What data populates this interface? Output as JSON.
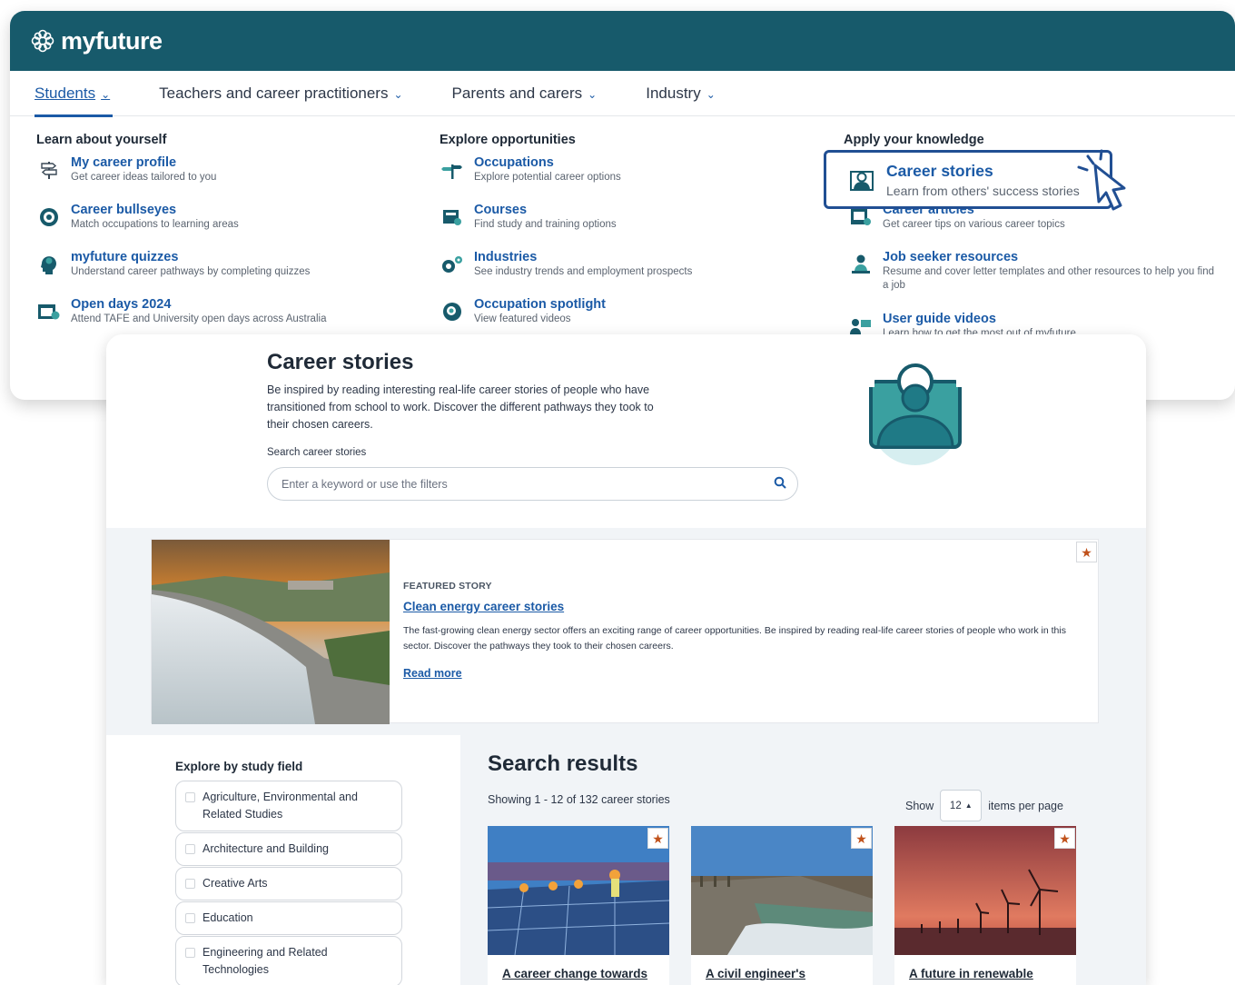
{
  "header": {
    "brand": "myfuture",
    "nav": [
      {
        "label": "Students"
      },
      {
        "label": "Teachers and career practitioners"
      },
      {
        "label": "Parents and carers"
      },
      {
        "label": "Industry"
      }
    ]
  },
  "mega_menu": {
    "columns": [
      {
        "heading": "Learn about yourself",
        "items": [
          {
            "title": "My career profile",
            "desc": "Get career ideas tailored to you",
            "icon": "signpost-icon"
          },
          {
            "title": "Career bullseyes",
            "desc": "Match occupations to learning areas",
            "icon": "target-icon"
          },
          {
            "title": "myfuture quizzes",
            "desc": "Understand career pathways by completing quizzes",
            "icon": "head-bulb-icon"
          },
          {
            "title": "Open days 2024",
            "desc": "Attend TAFE and University open days across Australia",
            "icon": "calendar-icon"
          }
        ]
      },
      {
        "heading": "Explore opportunities",
        "items": [
          {
            "title": "Occupations",
            "desc": "Explore potential career options",
            "icon": "signpost-icon"
          },
          {
            "title": "Courses",
            "desc": "Find study and training options",
            "icon": "book-icon"
          },
          {
            "title": "Industries",
            "desc": "See industry trends and employment prospects",
            "icon": "gears-icon"
          },
          {
            "title": "Occupation spotlight",
            "desc": "View featured videos",
            "icon": "spotlight-icon"
          }
        ]
      },
      {
        "heading": "Apply your knowledge",
        "items": [
          {
            "title": "Career articles",
            "desc": "Get career tips on various career topics",
            "icon": "articles-icon"
          },
          {
            "title": "Job seeker resources",
            "desc": "Resume and cover letter templates and other resources to help you find a job",
            "icon": "person-desk-icon"
          },
          {
            "title": "User guide videos",
            "desc": "Learn how to get the most out of myfuture",
            "icon": "video-guide-icon"
          }
        ]
      }
    ],
    "highlighted": {
      "title": "Career stories",
      "desc": "Learn from others' success stories",
      "icon": "person-frame-icon"
    }
  },
  "page": {
    "title": "Career stories",
    "intro": "Be inspired by reading interesting real-life career stories of people who have transitioned from school to work. Discover the different pathways they took to their chosen careers.",
    "search_label": "Search career stories",
    "search_placeholder": "Enter a keyword or use the filters"
  },
  "featured": {
    "tag": "FEATURED STORY",
    "title": "Clean energy career stories",
    "desc": "The fast-growing clean energy sector offers an exciting range of career opportunities. Be inspired by reading real-life career stories of people who work in this sector. Discover the pathways they took to their chosen careers.",
    "more": "Read more"
  },
  "filters": {
    "heading": "Explore by study field",
    "options": [
      "Agriculture, Environmental and Related Studies",
      "Architecture and Building",
      "Creative Arts",
      "Education",
      "Engineering and Related Technologies"
    ]
  },
  "results": {
    "heading": "Search results",
    "count": "Showing 1 - 12 of 132 career stories",
    "show_label": "Show",
    "per_page": "12",
    "per_page_suffix": "items per page",
    "cards": [
      {
        "title": "A career change towards"
      },
      {
        "title": "A civil engineer's"
      },
      {
        "title": "A future in renewable"
      }
    ]
  },
  "colors": {
    "brand_teal": "#175a6b",
    "link_blue": "#1b5aa6",
    "favourite_orange": "#c0511a"
  }
}
